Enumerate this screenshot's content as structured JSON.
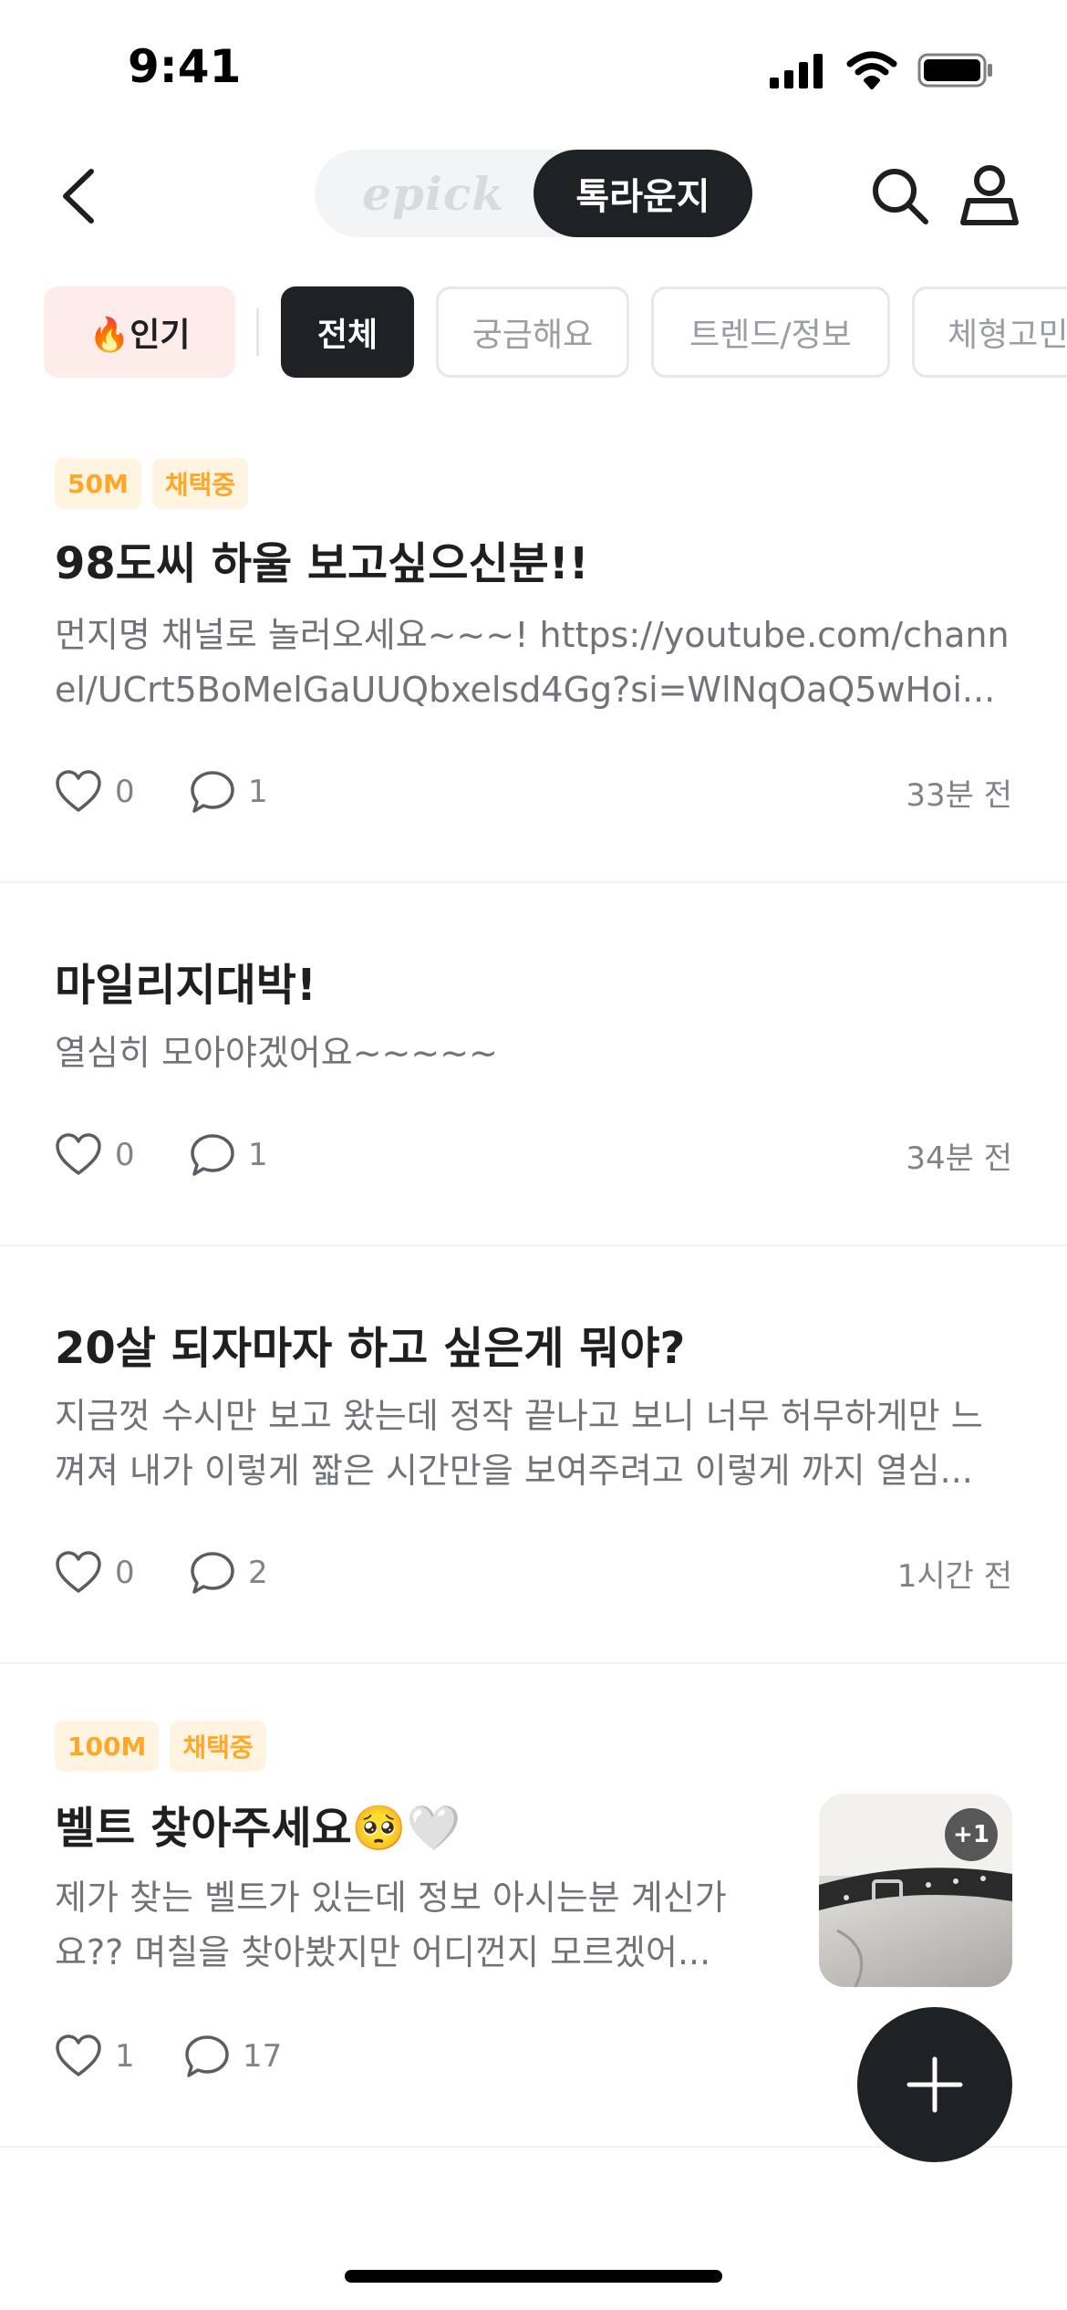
{
  "status_bar": {
    "time": "9:41"
  },
  "header": {
    "toggle_brand": "epick",
    "toggle_active": "톡라운지"
  },
  "chips": {
    "popular": "🔥인기",
    "all": "전체",
    "curious": "궁금해요",
    "trend": "트렌드/정보",
    "body": "체형고민"
  },
  "posts": [
    {
      "badges": [
        "50M",
        "채택중"
      ],
      "title": "98도씨 하울 보고싶으신분!!",
      "body": "먼지명 채널로 놀러오세요~~~! https://youtube.com/channel/UCrt5BoMelGaUUQbxelsd4Gg?si=WlNqOaQ5wHoi...",
      "likes": "0",
      "comments": "1",
      "time": "33분 전"
    },
    {
      "title": "마일리지대박!",
      "body": "열심히 모아야겠어요~~~~~",
      "likes": "0",
      "comments": "1",
      "time": "34분 전"
    },
    {
      "title": "20살 되자마자 하고 싶은게 뭐야?",
      "body": "지금껏 수시만 보고 왔는데 정작 끝나고 보니 너무 허무하게만 느껴져 내가 이렇게 짧은 시간만을 보여주려고 이렇게 까지 열심...",
      "likes": "0",
      "comments": "2",
      "time": "1시간 전"
    },
    {
      "badges": [
        "100M",
        "채택중"
      ],
      "title": "벨트 찾아주세요🥺🤍",
      "body": "제가 찾는 벨트가 있는데 정보 아시는분 계신가요?? 며칠을 찾아봤지만 어디껀지 모르겠어...",
      "likes": "1",
      "comments": "17",
      "image_count": "+1"
    }
  ],
  "colors": {
    "accent_dark": "#1f2224",
    "badge_text": "#ffa726",
    "badge_bg": "#fff3e2",
    "popular_bg": "#fdecea"
  }
}
